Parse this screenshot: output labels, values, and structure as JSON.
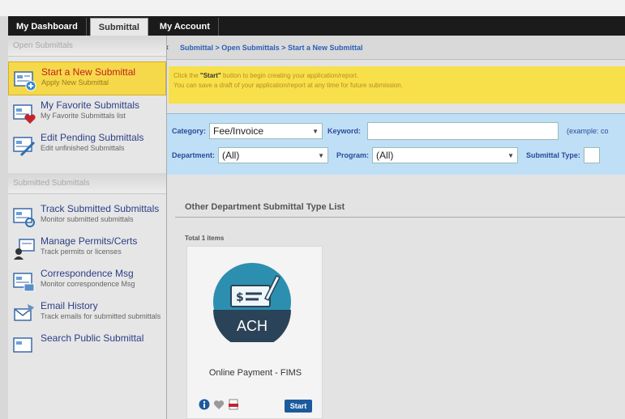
{
  "nav": {
    "tabs": [
      "My Dashboard",
      "Submittal",
      "My Account"
    ]
  },
  "sidebar": {
    "open_header": "Open Submittals",
    "open_items": [
      {
        "title": "Start a New Submittal",
        "sub": "Apply New Submittal"
      },
      {
        "title": "My Favorite Submittals",
        "sub": "My Favorite Submittals list"
      },
      {
        "title": "Edit Pending Submittals",
        "sub": "Edit unfinished Submittals"
      }
    ],
    "submitted_header": "Submitted Submittals",
    "submitted_items": [
      {
        "title": "Track Submitted Submittals",
        "sub": "Monitor submitted submittals"
      },
      {
        "title": "Manage Permits/Certs",
        "sub": "Track permits or licenses"
      },
      {
        "title": "Correspondence Msg",
        "sub": "Monitor correspondence Msg"
      },
      {
        "title": "Email History",
        "sub": "Track emails for submitted submittals"
      },
      {
        "title": "Search Public Submittal",
        "sub": ""
      }
    ]
  },
  "main": {
    "breadcrumb": "Submittal > Open Submittals > Start a New Submittal",
    "notice_line1_pre": "Click the ",
    "notice_line1_bold": "\"Start\"",
    "notice_line1_post": " button to begin creating your application/report.",
    "notice_line2": "You can save a draft of your application/report at any time for future submission.",
    "filters": {
      "category_label": "Category:",
      "category_value": "Fee/Invoice",
      "keyword_label": "Keyword:",
      "keyword_value": "",
      "example_text": "(example: co",
      "department_label": "Department:",
      "department_value": "(All)",
      "program_label": "Program:",
      "program_value": "(All)",
      "type_label": "Submittal Type:"
    },
    "list_title": "Other Department Submittal Type List",
    "total": "Total 1 items",
    "card": {
      "icon_text": "ACH",
      "title": "Online Payment - FIMS",
      "start_label": "Start"
    }
  },
  "colors": {
    "notice_bg": "#f8e04a",
    "filter_bg": "#bfdff6",
    "active_item_bg": "#f6d94a",
    "start_button": "#1c5a9e",
    "ach_teal": "#2c8fb0"
  }
}
